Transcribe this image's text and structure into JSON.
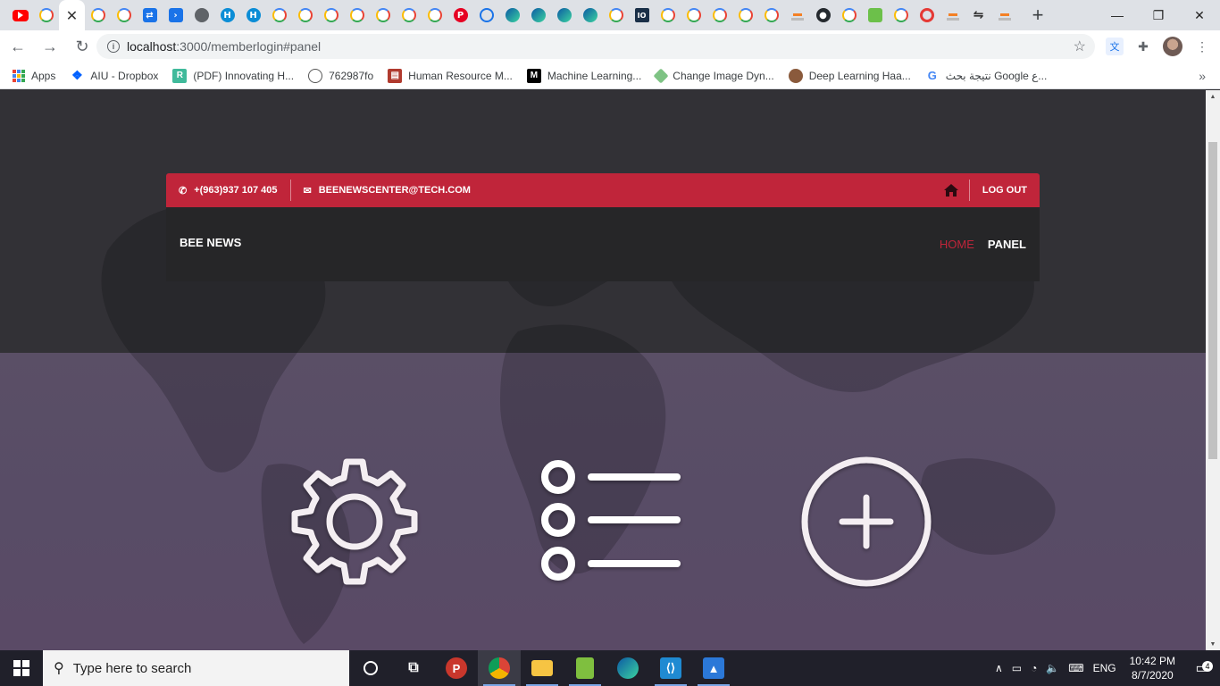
{
  "browser": {
    "tabs": [
      {
        "icon": "youtube-icon"
      },
      {
        "icon": "google-icon"
      },
      {
        "icon": "close-icon",
        "active": true
      },
      {
        "icon": "google-icon"
      },
      {
        "icon": "google-icon"
      },
      {
        "icon": "sync-icon"
      },
      {
        "icon": "terminal-icon"
      },
      {
        "icon": "globe-icon"
      },
      {
        "icon": "hub-icon"
      },
      {
        "icon": "hub-icon"
      },
      {
        "icon": "google-icon"
      },
      {
        "icon": "google-icon"
      },
      {
        "icon": "google-icon"
      },
      {
        "icon": "google-icon"
      },
      {
        "icon": "google-icon"
      },
      {
        "icon": "google-icon"
      },
      {
        "icon": "google-icon"
      },
      {
        "icon": "pinterest-icon"
      },
      {
        "icon": "history-icon"
      },
      {
        "icon": "edge-icon"
      },
      {
        "icon": "edge-icon"
      },
      {
        "icon": "edge-icon"
      },
      {
        "icon": "edge-icon"
      },
      {
        "icon": "google-icon"
      },
      {
        "icon": "io-icon"
      },
      {
        "icon": "google-icon"
      },
      {
        "icon": "google-icon"
      },
      {
        "icon": "google-icon"
      },
      {
        "icon": "google-icon"
      },
      {
        "icon": "google-icon"
      },
      {
        "icon": "stackoverflow-icon"
      },
      {
        "icon": "github-icon"
      },
      {
        "icon": "google-icon"
      },
      {
        "icon": "green-app-icon"
      },
      {
        "icon": "google-icon"
      },
      {
        "icon": "red-circle-icon"
      },
      {
        "icon": "stackoverflow-icon"
      },
      {
        "icon": "arrows-icon"
      },
      {
        "icon": "stackoverflow-icon"
      }
    ],
    "new_tab": "+",
    "window": {
      "minimize": "—",
      "restore": "❐",
      "close": "✕"
    },
    "url_host": "localhost",
    "url_rest": ":3000/memberlogin#panel",
    "bookmarks": [
      {
        "label": "Apps",
        "icon": "apps-grid-icon"
      },
      {
        "label": "AIU - Dropbox",
        "icon": "dropbox-icon"
      },
      {
        "label": "(PDF) Innovating H...",
        "icon": "researchgate-icon"
      },
      {
        "label": "762987fo",
        "icon": "circle-icon"
      },
      {
        "label": "Human Resource M...",
        "icon": "hr-icon"
      },
      {
        "label": "Machine Learning...",
        "icon": "medium-icon"
      },
      {
        "label": "Change Image Dyn...",
        "icon": "cid-icon"
      },
      {
        "label": "Deep Learning Haa...",
        "icon": "person-icon"
      },
      {
        "label": "نتيجة بحث Google ع...",
        "icon": "google-icon"
      }
    ],
    "bookmarks_more": "»"
  },
  "site": {
    "phone": "+(963)937 107 405",
    "email": "BEENEWSCENTER@TECH.COM",
    "logout": "LOG OUT",
    "brand": "BEE NEWS",
    "menu": {
      "home": "HOME",
      "panel": "PANEL"
    },
    "accent": "#c0253a",
    "panel_icons": [
      "gear-icon",
      "list-icon",
      "plus-circle-icon"
    ]
  },
  "taskbar": {
    "search_placeholder": "Type here to search",
    "language": "ENG",
    "time": "10:42 PM",
    "date": "8/7/2020",
    "notifications": "4"
  }
}
